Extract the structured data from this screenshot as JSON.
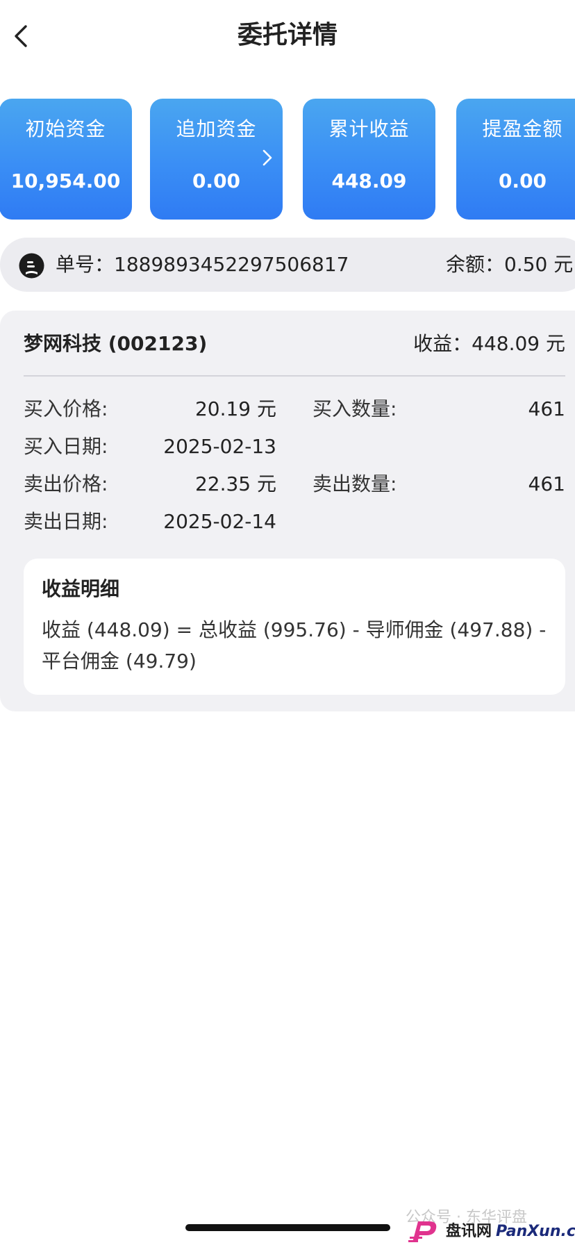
{
  "header": {
    "title": "委托详情",
    "back_icon": "chevron-left-icon"
  },
  "summary_cards": [
    {
      "label": "初始资金",
      "value": "10,954.00"
    },
    {
      "label": "追加资金",
      "value": "0.00",
      "icon": "chevron-right-icon"
    },
    {
      "label": "累计收益",
      "value": "448.09"
    },
    {
      "label": "提盈金额",
      "value": "0.00"
    }
  ],
  "order": {
    "icon": "order-icon",
    "number_text": "单号：1889893452297506817",
    "balance_text": "余额：0.50 元"
  },
  "detail": {
    "stock_name": "梦网科技 (002123)",
    "profit_text": "收益：448.09 元",
    "buy_price_label": "买入价格:",
    "buy_price_value": "20.19 元",
    "buy_qty_label": "买入数量:",
    "buy_qty_value": "461",
    "buy_date_label": "买入日期:",
    "buy_date_value": "2025-02-13",
    "sell_price_label": "卖出价格:",
    "sell_price_value": "22.35 元",
    "sell_qty_label": "卖出数量:",
    "sell_qty_value": "461",
    "sell_date_label": "卖出日期:",
    "sell_date_value": "2025-02-14"
  },
  "breakdown": {
    "title": "收益明细",
    "text": "收益 (448.09) = 总收益 (995.76) - 导师佣金 (497.88) - 平台佣金 (49.79)"
  },
  "watermark": {
    "wechat_text": "公众号 · 东华评盘",
    "site_cn": "盘讯网",
    "site_en": "PanXun.cc"
  },
  "colors": {
    "card_gradient_top": "#4aa6f0",
    "card_gradient_bottom": "#2f7bf3",
    "panel_bg": "#f1f1f4",
    "order_bar_bg": "#ececf0"
  }
}
